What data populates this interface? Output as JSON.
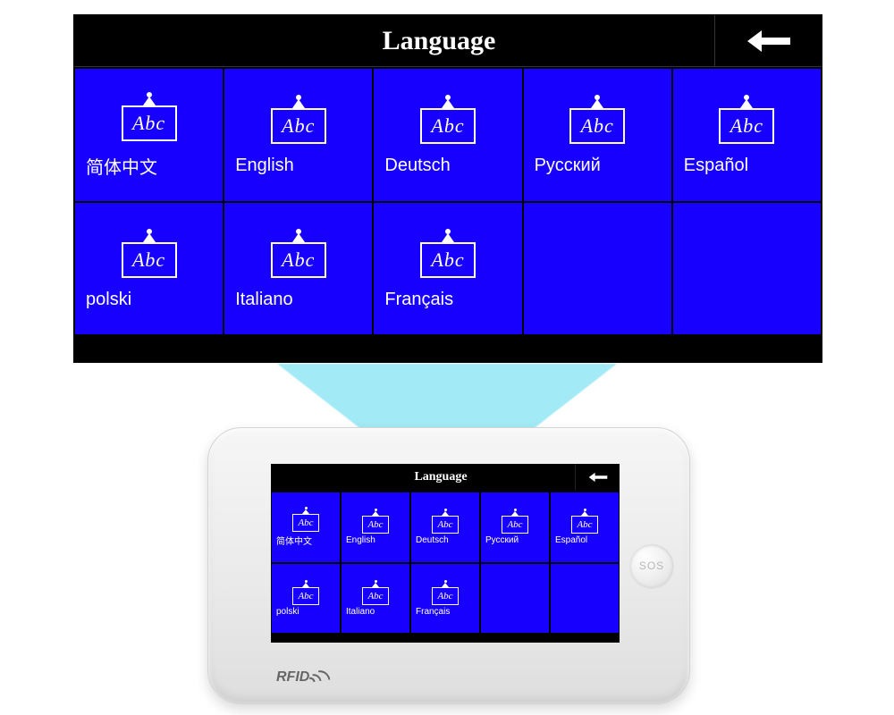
{
  "header": {
    "title": "Language"
  },
  "icon_text": "Abc",
  "languages": [
    {
      "label": "简体中文"
    },
    {
      "label": "English"
    },
    {
      "label": "Deutsch"
    },
    {
      "label": "Русский"
    },
    {
      "label": "Español"
    },
    {
      "label": "polski"
    },
    {
      "label": "Italiano"
    },
    {
      "label": "Français"
    }
  ],
  "device": {
    "sos_label": "SOS",
    "rfid_label": "RFID"
  }
}
